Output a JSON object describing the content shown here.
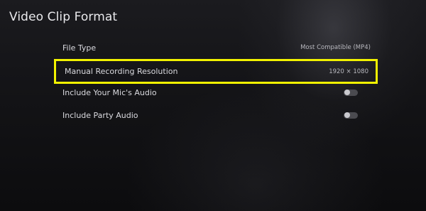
{
  "page": {
    "title": "Video Clip Format"
  },
  "settings": [
    {
      "label": "File Type",
      "value": "Most Compatible (MP4)"
    },
    {
      "label": "Manual Recording Resolution",
      "value": "1920 × 1080"
    },
    {
      "label": "Include Your Mic's Audio",
      "toggle_state": "off"
    },
    {
      "label": "Include Party Audio",
      "toggle_state": "off"
    }
  ],
  "colors": {
    "highlight": "#f2f200",
    "background": "#141417",
    "text": "#dadadf"
  },
  "icons": {
    "toggle": "toggle-switch-icon"
  }
}
